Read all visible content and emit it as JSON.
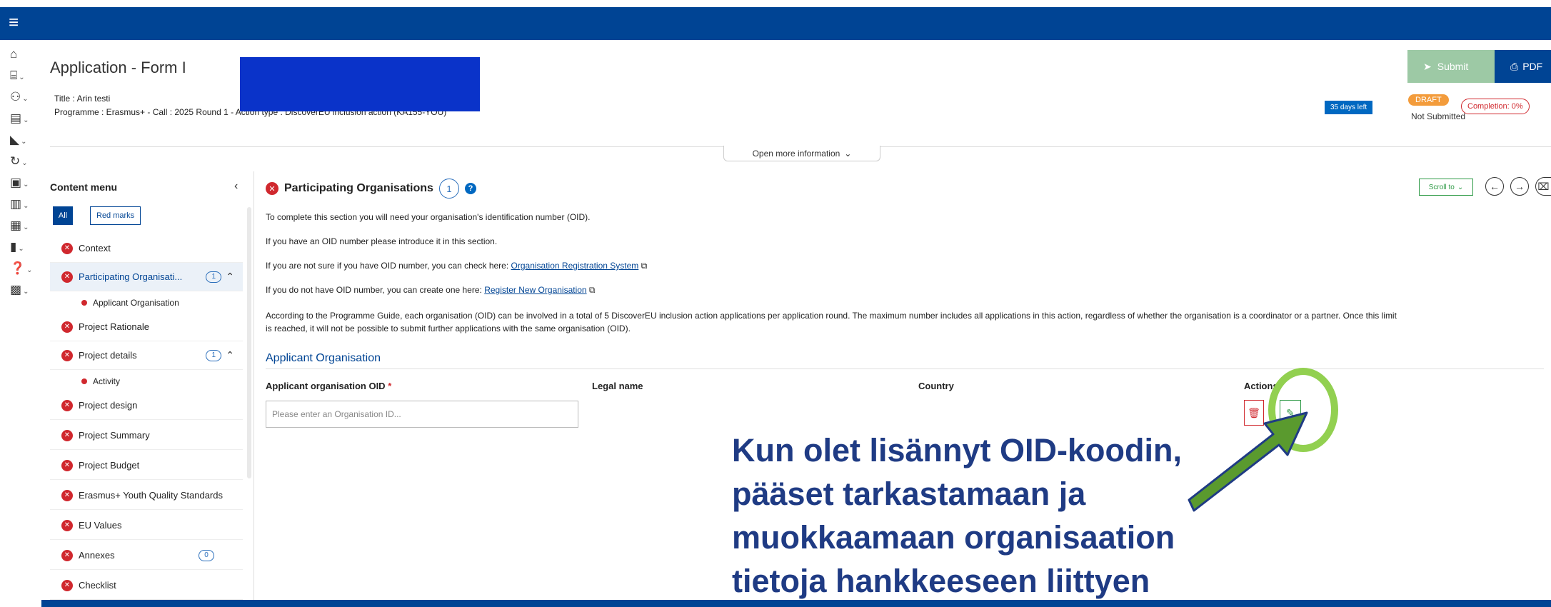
{
  "app": {
    "title": "Application - Form I",
    "title_line": "Title : Arin testi",
    "programme_line": "Programme : Erasmus+ - Call : 2025 Round 1 - Action type : DiscoverEU inclusion action (KA155-YOU)"
  },
  "header": {
    "submit_label": "Submit",
    "pdf_label": "PDF",
    "days_left": "35 days left",
    "draft_badge": "DRAFT",
    "status": "Not Submitted",
    "completion": "Completion: 0%",
    "open_more": "Open more information"
  },
  "rail_icons": [
    "home-icon",
    "institution-icon",
    "network-icon",
    "document-icon",
    "megaphone-icon",
    "refresh-icon",
    "bus-icon",
    "clipboard-icon",
    "library-icon",
    "chart-icon",
    "help-icon",
    "report-icon"
  ],
  "sidebar": {
    "title": "Content menu",
    "filter_all": "All",
    "filter_red": "Red marks",
    "items": [
      {
        "label": "Context"
      },
      {
        "label": "Participating Organisati...",
        "count": "1",
        "expanded": true
      },
      {
        "label": "Applicant Organisation"
      },
      {
        "label": "Project Rationale"
      },
      {
        "label": "Project details",
        "count": "1",
        "expanded": true
      },
      {
        "label": "Activity"
      },
      {
        "label": "Project design"
      },
      {
        "label": "Project Summary"
      },
      {
        "label": "Project Budget"
      },
      {
        "label": "Erasmus+ Youth Quality Standards"
      },
      {
        "label": "EU Values"
      },
      {
        "label": "Annexes",
        "count": "0"
      },
      {
        "label": "Checklist"
      }
    ]
  },
  "main": {
    "section_title": "Participating Organisations",
    "section_count": "1",
    "scroll_to": "Scroll to",
    "p1": "To complete this section you will need your organisation's identification number (OID).",
    "p2": "If you have an OID number please introduce it in this section.",
    "p3_text": "If you are not sure if you have OID number, you can check here:",
    "p3_link": "Organisation Registration System",
    "p4_text": "If you do not have OID number, you can create one here:",
    "p4_link": "Register New Organisation",
    "p5": "According to the Programme Guide, each organisation (OID) can be involved in a total of 5 DiscoverEU inclusion action applications per application round. The maximum number includes all applications in this action, regardless of whether the organisation is a coordinator or a partner. Once this limit",
    "p6": "is reached, it will not be possible to submit further applications with the same organisation (OID).",
    "subsection": "Applicant Organisation",
    "col_oid": "Applicant organisation OID",
    "col_oid_req": "*",
    "col_legal": "Legal name",
    "col_country": "Country",
    "col_actions": "Actions",
    "oid_placeholder": "Please enter an Organisation ID..."
  },
  "callout": {
    "text": "Kun olet lisännyt OID-koodin, pääset tarkastamaan ja muokkaamaan organisaation tietoja hankkeeseen liittyen"
  },
  "colors": {
    "brand_blue": "#004494",
    "error_red": "#d0282e",
    "success_green": "#2e9a46",
    "highlight_green": "#92d050",
    "callout_text": "#1f3b84"
  }
}
